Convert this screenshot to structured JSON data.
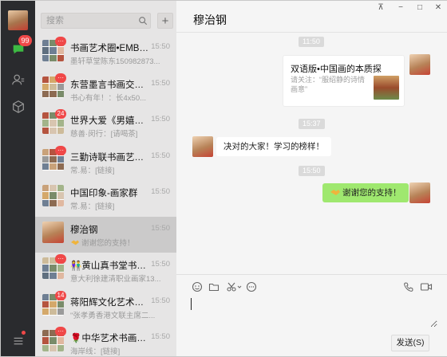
{
  "search": {
    "placeholder": "搜索"
  },
  "nav": {
    "unread_badge": "99"
  },
  "chats": [
    {
      "name": "书画艺术圈•EMBA...",
      "time": "15:50",
      "preview": "墨轩草堂陈东150982873...",
      "unread": "···"
    },
    {
      "name": "东营墨言书画交流群",
      "time": "15:50",
      "preview": "书心有年！：长4x50...",
      "unread": "···"
    },
    {
      "name": "世界大爱《男嬉女嫁...",
      "time": "15:50",
      "preview": "慈善·闵行：[请喝茶]",
      "unread": "24"
    },
    {
      "name": "三勤诗联书画艺术交...",
      "time": "15:50",
      "preview": "常.易：[链接]",
      "unread": "···"
    },
    {
      "name": "中国印象-画家群",
      "time": "15:50",
      "preview": "常.易：[链接]",
      "unread": ""
    },
    {
      "name": "穆治钢",
      "time": "15:50",
      "preview": "谢谢您的支持！",
      "unread": ""
    },
    {
      "name": "黄山真书堂书画群",
      "time": "15:50",
      "preview": "意大利徐建清职业画家13...",
      "unread": "···"
    },
    {
      "name": "蒋阳辉文化艺术院二...",
      "time": "15:50",
      "preview": "\"张孝勇香港文联主席二...",
      "unread": "14"
    },
    {
      "name": "中华艺术书画诗...",
      "time": "15:50",
      "preview": "海岸线：[链接]",
      "unread": "···"
    }
  ],
  "conversation": {
    "title": "穆治钢",
    "timestamps": [
      "11:50",
      "15:37",
      "15:50"
    ],
    "card": {
      "title": "双语版•中国画的本质探",
      "desc": "请关注：“服绍静的诗情画意”"
    },
    "message_left": "决对的大家！学习的榜样！",
    "message_right": "谢谢您的支持！"
  },
  "composer": {
    "send_label": "发送(S)"
  },
  "window": {
    "pin": "⊼",
    "minimize": "−",
    "maximize": "□",
    "close": "✕"
  },
  "colors": {
    "accent_green": "#9fe86f",
    "badge_red": "#f04848",
    "sidebar_dark": "#2a2b2e"
  }
}
